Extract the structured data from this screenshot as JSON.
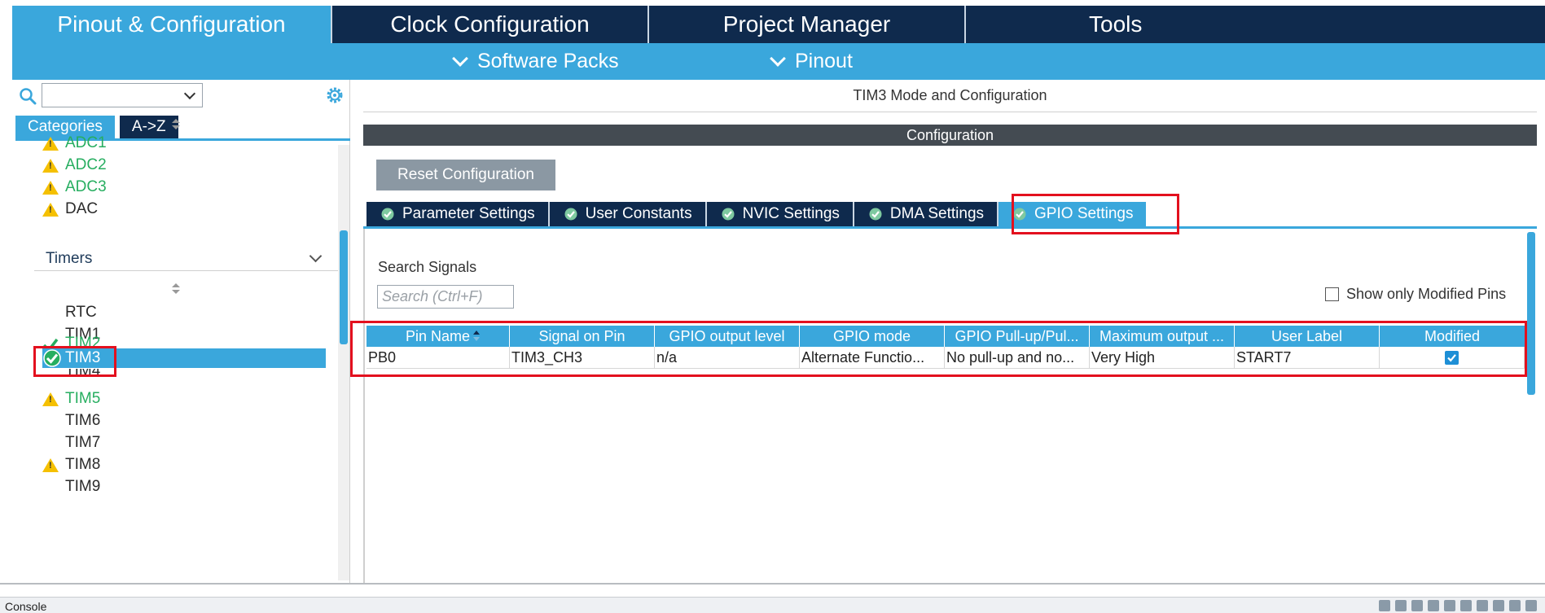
{
  "top_tabs": [
    {
      "label": "Pinout & Configuration"
    },
    {
      "label": "Clock Configuration"
    },
    {
      "label": "Project Manager"
    },
    {
      "label": "Tools"
    }
  ],
  "sub_menu": [
    {
      "label": "Software Packs"
    },
    {
      "label": "Pinout"
    }
  ],
  "left_panel": {
    "search_value": "",
    "category_tabs": [
      {
        "label": "Categories"
      },
      {
        "label": "A->Z"
      }
    ],
    "analog_items": [
      {
        "label": "ADC1",
        "status": "warning"
      },
      {
        "label": "ADC2",
        "status": "warning"
      },
      {
        "label": "ADC3",
        "status": "warning"
      },
      {
        "label": "DAC",
        "status": "warning"
      }
    ],
    "timers_header": "Timers",
    "timer_items": [
      {
        "label": "RTC",
        "status": "none"
      },
      {
        "label": "TIM1",
        "status": "none"
      },
      {
        "label": "TIM2",
        "status": "ok"
      },
      {
        "label": "TIM3",
        "status": "ok-selected"
      },
      {
        "label": "TIM4",
        "status": "none"
      },
      {
        "label": "TIM5",
        "status": "warning"
      },
      {
        "label": "TIM6",
        "status": "none"
      },
      {
        "label": "TIM7",
        "status": "none"
      },
      {
        "label": "TIM8",
        "status": "warning"
      },
      {
        "label": "TIM9",
        "status": "none"
      }
    ]
  },
  "right_panel": {
    "header_title": "TIM3 Mode and Configuration",
    "config_title": "Configuration",
    "reset_button": "Reset Configuration",
    "config_tabs": [
      {
        "label": "Parameter Settings"
      },
      {
        "label": "User Constants"
      },
      {
        "label": "NVIC Settings"
      },
      {
        "label": "DMA Settings"
      },
      {
        "label": "GPIO Settings"
      }
    ],
    "search_signals_label": "Search Signals",
    "search_signals_placeholder": "Search (Ctrl+F)",
    "show_modified_label": "Show only Modified Pins",
    "table": {
      "columns": [
        "Pin Name",
        "Signal on Pin",
        "GPIO output level",
        "GPIO mode",
        "GPIO Pull-up/Pul...",
        "Maximum output ...",
        "User Label",
        "Modified"
      ],
      "rows": [
        [
          "PB0",
          "TIM3_CH3",
          "n/a",
          "Alternate Functio...",
          "No pull-up and no...",
          "Very High",
          "START7",
          "checked"
        ]
      ]
    }
  },
  "bottom": {
    "console_label": "Console"
  },
  "colors": {
    "accent": "#3aa7dc",
    "navy": "#0f2a4d",
    "highlight_red": "#e3101e",
    "ok_green": "#27ae60",
    "warning_yellow": "#f5c000"
  }
}
